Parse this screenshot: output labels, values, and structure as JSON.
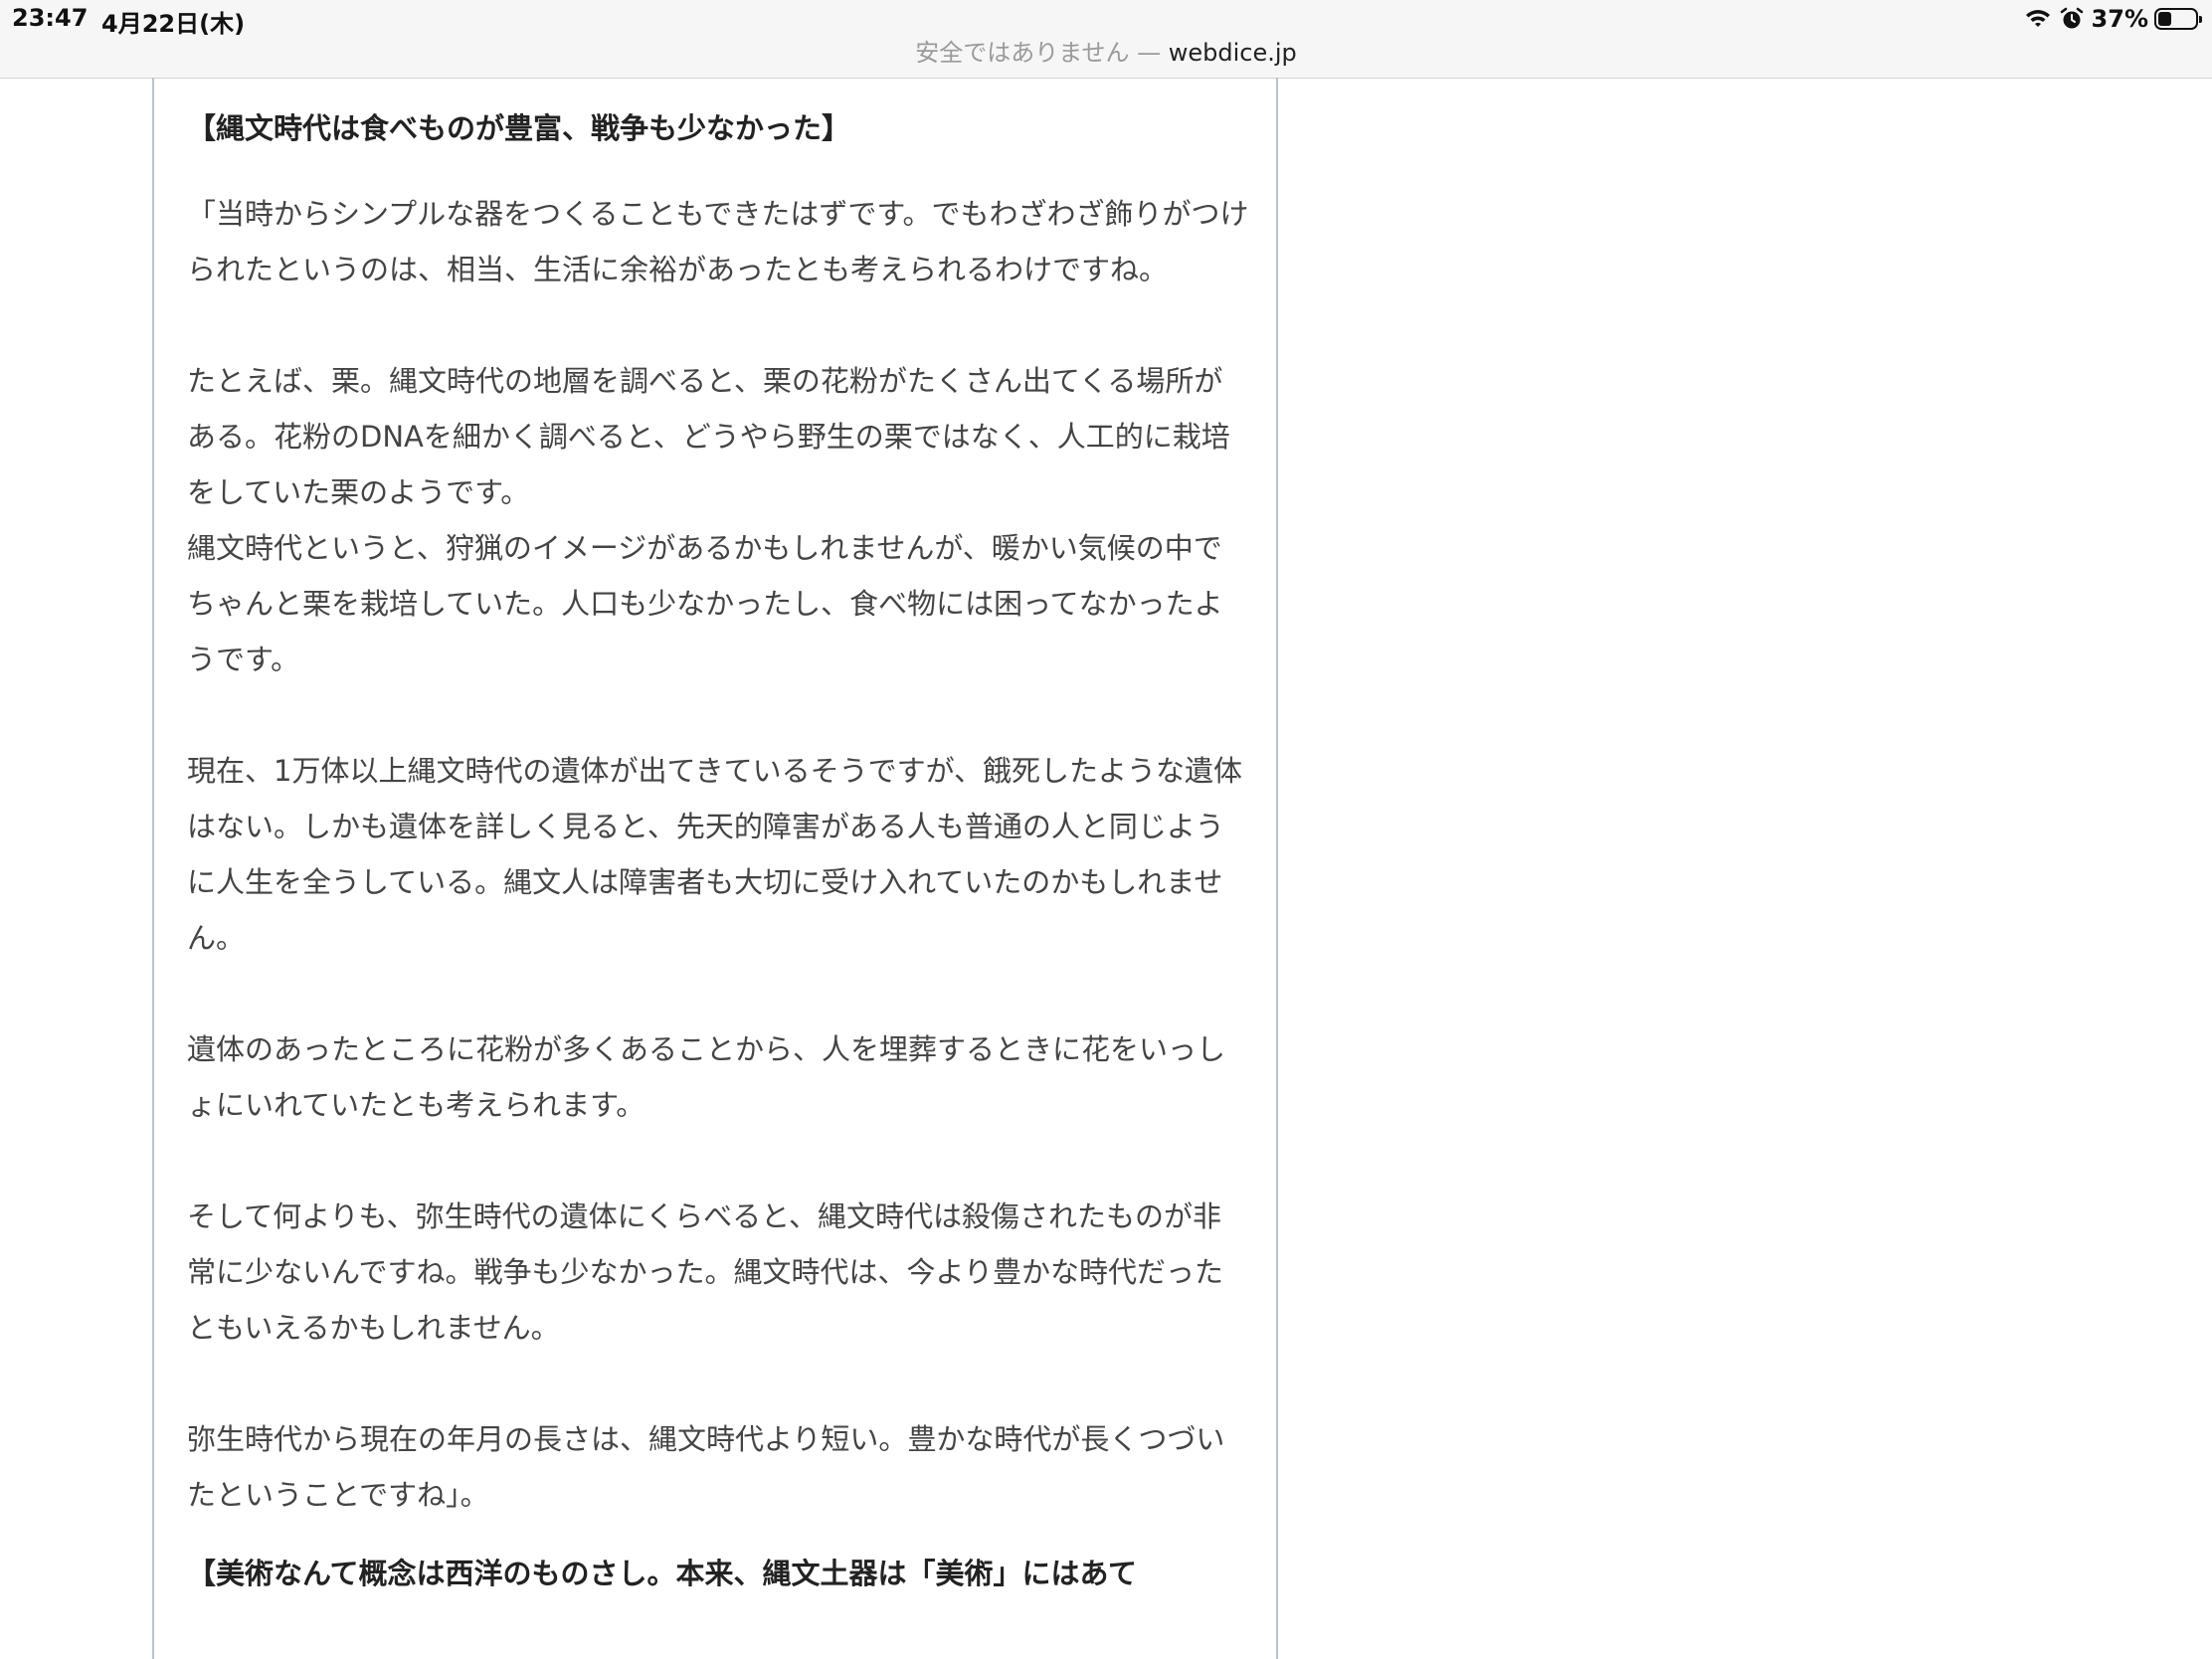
{
  "status_bar": {
    "time": "23:47",
    "date": "4月22日(木)",
    "battery_percent": "37%",
    "battery_level": 0.37
  },
  "address_bar": {
    "security_warning": "安全ではありません",
    "separator": "—",
    "domain": "webdice.jp"
  },
  "article": {
    "heading": "【縄文時代は食べものが豊富、戦争も少なかった】",
    "paragraphs": [
      "「当時からシンプルな器をつくることもできたはずです。でもわざわざ飾りがつけられたというのは、相当、生活に余裕があったとも考えられるわけですね。",
      "たとえば、栗。縄文時代の地層を調べると、栗の花粉がたくさん出てくる場所がある。花粉のDNAを細かく調べると、どうやら野生の栗ではなく、人工的に栽培をしていた栗のようです。",
      "縄文時代というと、狩猟のイメージがあるかもしれませんが、暖かい気候の中でちゃんと栗を栽培していた。人口も少なかったし、食べ物には困ってなかったようです。",
      "現在、1万体以上縄文時代の遺体が出てきているそうですが、餓死したような遺体はない。しかも遺体を詳しく見ると、先天的障害がある人も普通の人と同じように人生を全うしている。縄文人は障害者も大切に受け入れていたのかもしれません。",
      "遺体のあったところに花粉が多くあることから、人を埋葬するときに花をいっしょにいれていたとも考えられます。",
      "そして何よりも、弥生時代の遺体にくらべると、縄文時代は殺傷されたものが非常に少ないんですね。戦争も少なかった。縄文時代は、今より豊かな時代だったともいえるかもしれません。",
      "弥生時代から現在の年月の長さは、縄文時代より短い。豊かな時代が長くつづいたということですね」。"
    ],
    "next_heading": "【美術なんて概念は西洋のものさし。本来、縄文土器は「美術」にはあて"
  }
}
